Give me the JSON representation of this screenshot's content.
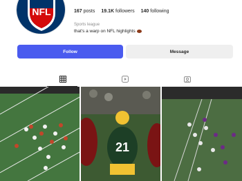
{
  "profile": {
    "logo_alt": "NFL",
    "stats": {
      "posts_count": "167",
      "posts_label": "posts",
      "followers_count": "19.1K",
      "followers_label": "followers",
      "following_count": "140",
      "following_label": "following"
    },
    "category": "Sports league",
    "bio": "that's a warp on NFL highlights"
  },
  "actions": {
    "follow_label": "Follow",
    "message_label": "Message"
  },
  "tabs": [
    {
      "icon": "grid-icon",
      "active": true
    },
    {
      "icon": "reels-icon",
      "active": false
    },
    {
      "icon": "tagged-icon",
      "active": false
    }
  ],
  "posts": [
    {
      "jersey_number": ""
    },
    {
      "jersey_number": "21"
    },
    {
      "jersey_number": ""
    }
  ],
  "colors": {
    "follow_blue": "#4a5bef",
    "message_gray": "#efefef",
    "nfl_blue": "#013369",
    "nfl_red": "#d50a0a"
  }
}
